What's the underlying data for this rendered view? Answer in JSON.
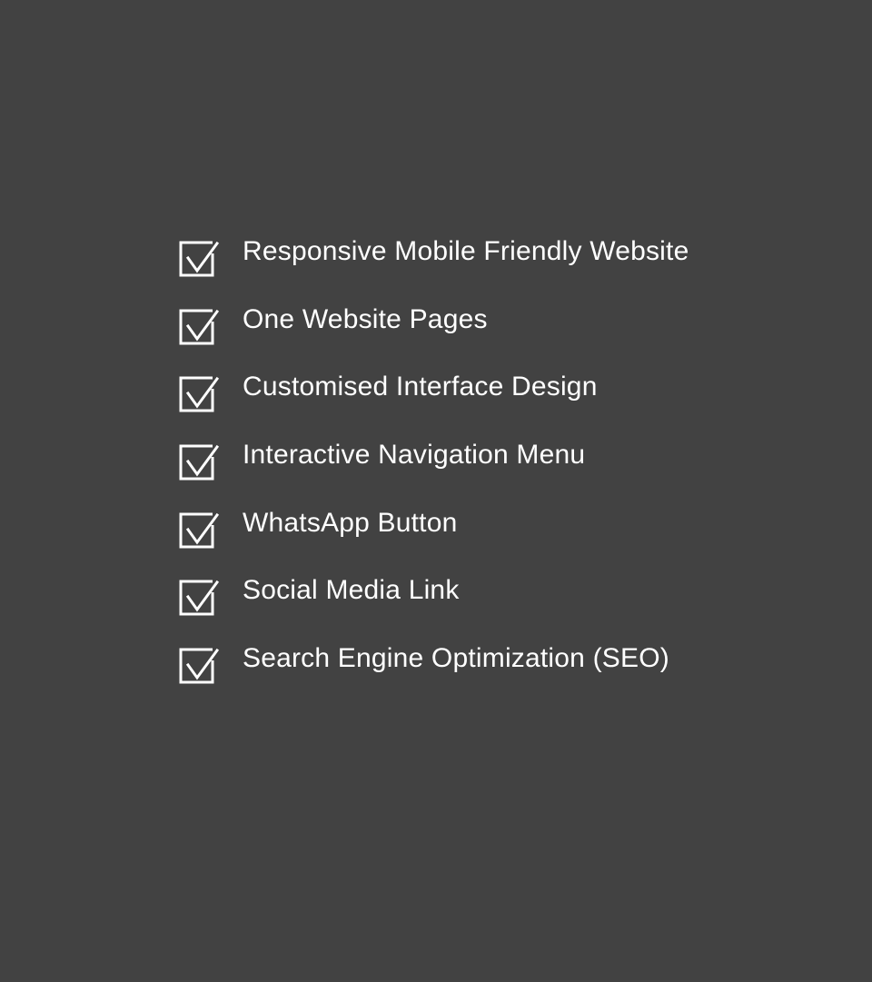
{
  "colors": {
    "background": "#424242",
    "text": "#ffffff",
    "icon": "#ffffff"
  },
  "features": {
    "icon": "checked-box-icon",
    "items": [
      {
        "label": "Responsive Mobile Friendly Website"
      },
      {
        "label": "One Website Pages"
      },
      {
        "label": "Customised Interface Design"
      },
      {
        "label": "Interactive Navigation Menu"
      },
      {
        "label": "WhatsApp Button"
      },
      {
        "label": "Social Media Link"
      },
      {
        "label": "Search Engine Optimization (SEO)"
      }
    ]
  }
}
